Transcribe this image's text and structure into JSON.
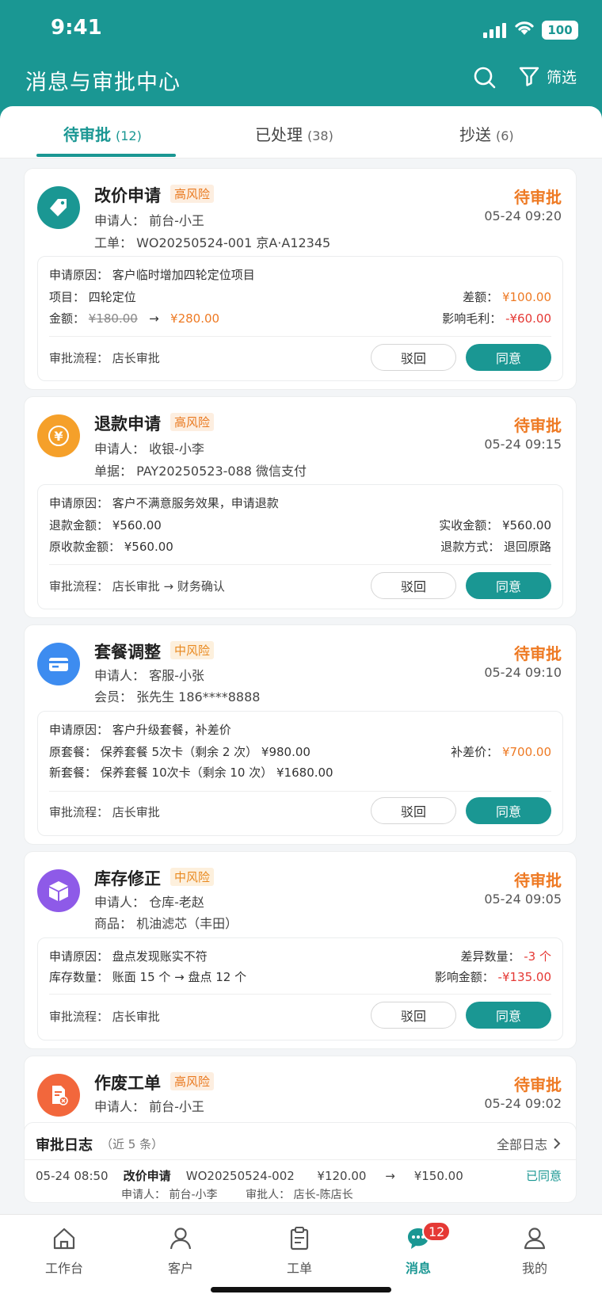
{
  "status_bar": {
    "time": "9:41",
    "battery": "100"
  },
  "header": {
    "title": "消息与审批中心",
    "filter_label": "筛选"
  },
  "tabs": [
    {
      "label": "待审批",
      "count": "(12)"
    },
    {
      "label": "已处理",
      "count": "(38)"
    },
    {
      "label": "抄送",
      "count": "(6)"
    }
  ],
  "cards": [
    {
      "title": "改价申请",
      "risk": "高风险",
      "status": "待审批",
      "time": "05-24 09:20",
      "l1": "申请人：  前台-小王",
      "l2": "工单：  WO20250524-001    京A·A12345",
      "reason": "申请原因：  客户临时增加四轮定位项目",
      "item": "项目：  四轮定位",
      "diff_label": "差额：",
      "diff_value": "¥100.00",
      "amt_label": "金额：",
      "amt_old": "¥180.00",
      "arrow": "→",
      "amt_new": "¥280.00",
      "gp_label": "影响毛利：",
      "gp_value": "-¥60.00",
      "flow": "审批流程：  店长审批",
      "reject": "驳回",
      "approve": "同意"
    },
    {
      "title": "退款申请",
      "risk": "高风险",
      "status": "待审批",
      "time": "05-24 09:15",
      "l1": "申请人：  收银-小李",
      "l2": "单据：  PAY20250523-088    微信支付",
      "reason": "申请原因：  客户不满意服务效果，申请退款",
      "d1l": "退款金额：  ¥560.00",
      "d1r": "实收金额：  ¥560.00",
      "d2l": "原收款金额：  ¥560.00",
      "d2r": "退款方式：  退回原路",
      "flow": "审批流程：  店长审批 → 财务确认",
      "reject": "驳回",
      "approve": "同意"
    },
    {
      "title": "套餐调整",
      "risk": "中风险",
      "status": "待审批",
      "time": "05-24 09:10",
      "l1": "申请人：  客服-小张",
      "l2": "会员：  张先生    186****8888",
      "reason": "申请原因：  客户升级套餐，补差价",
      "d1l": "原套餐：  保养套餐 5次卡（剩余 2 次）      ¥980.00",
      "d1r_label": "补差价：",
      "d1r_value": "¥700.00",
      "d2l": "新套餐：  保养套餐 10次卡（剩余 10 次）    ¥1680.00",
      "flow": "审批流程：  店长审批",
      "reject": "驳回",
      "approve": "同意"
    },
    {
      "title": "库存修正",
      "risk": "中风险",
      "status": "待审批",
      "time": "05-24 09:05",
      "l1": "申请人：  仓库-老赵",
      "l2": "商品：  机油滤芯（丰田）",
      "reason": "申请原因：  盘点发现账实不符",
      "d1r_label": "差异数量：",
      "d1r_value": "-3 个",
      "d2l": "库存数量：  账面 15 个    →    盘点 12 个",
      "d2r_label": "影响金额：",
      "d2r_value": "-¥135.00",
      "flow": "审批流程：  店长审批",
      "reject": "驳回",
      "approve": "同意"
    },
    {
      "title": "作废工单",
      "risk": "高风险",
      "status": "待审批",
      "time": "05-24 09:02",
      "l1": "申请人：  前台-小王"
    }
  ],
  "log": {
    "title": "审批日志",
    "subtitle": "（近 5 条）",
    "all": "全部日志",
    "entry": {
      "time": "05-24 08:50",
      "type": "改价申请",
      "order": "WO20250524-002",
      "from": "¥120.00",
      "arrow": "→",
      "to": "¥150.00",
      "status": "已同意",
      "applicant": "申请人：  前台-小李",
      "approver": "审批人：  店长-陈店长"
    }
  },
  "nav": [
    {
      "label": "工作台",
      "icon": "home-icon"
    },
    {
      "label": "客户",
      "icon": "person-icon"
    },
    {
      "label": "工单",
      "icon": "clipboard-icon"
    },
    {
      "label": "消息",
      "icon": "chat-icon",
      "badge": "12"
    },
    {
      "label": "我的",
      "icon": "profile-icon"
    }
  ],
  "colors": {
    "primary": "#1a9793",
    "warning": "#ee7a24",
    "danger": "#e53935"
  }
}
